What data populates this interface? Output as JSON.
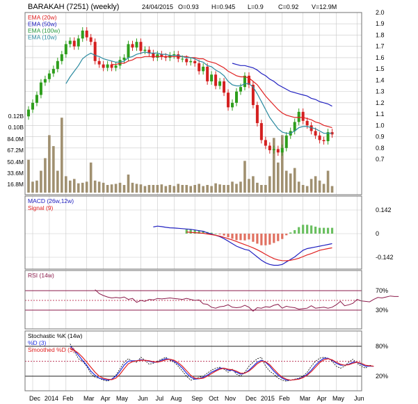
{
  "header": {
    "title": "BARAKAH (7251) (weekly)",
    "date": "24/04/2015",
    "open": "O=0.93",
    "high": "H=0.945",
    "low": "L=0.9",
    "close": "C=0.92",
    "volume": "V=12.9M"
  },
  "colors": {
    "up": "#2e9e1c",
    "down": "#d42020",
    "volume": "#a09070",
    "ema20": "#e02020",
    "ema50": "#2020c0",
    "ema100": "#2a9a40",
    "ema10": "#2a8aa0",
    "grid": "#c8c8c8",
    "frame": "#888888",
    "rsi_band": "#8b1a4a",
    "stoch_k": "#000000",
    "stoch_d": "#2030e0",
    "stoch_sd": "#e02020",
    "macd_hist_pos": "#6abf60",
    "macd_hist_neg": "#e07060"
  },
  "chart_data": [
    {
      "type": "candlestick",
      "panel": "price",
      "title": "BARAKAH (7251) (weekly)",
      "legend": [
        "EMA (20w)",
        "EMA (50w)",
        "EMA (100w)",
        "EMA (10w)"
      ],
      "legend_placement": "top-left",
      "y_ticks": [
        "2.0",
        "1.9",
        "1.8",
        "1.7",
        "1.6",
        "1.5",
        "1.4",
        "1.3",
        "1.2",
        "1.1",
        "1.0",
        "0.9",
        "0.8",
        "0.7"
      ],
      "ylim": [
        0.6,
        2.0
      ],
      "volume_ticks": [
        "0.12B",
        "0.10B",
        "84.0M",
        "67.2M",
        "50.4M",
        "33.6M",
        "16.8M"
      ],
      "volume_max": 150,
      "x_labels": [
        "Dec",
        "2014",
        "Feb",
        "Mar",
        "Apr",
        "May",
        "Jun",
        "Jul",
        "Aug",
        "Sep",
        "Oct",
        "Nov",
        "Dec",
        "2015",
        "Feb",
        "Mar",
        "Apr",
        "May",
        "Jun"
      ],
      "x_label_weeks": [
        3,
        7,
        11,
        16,
        20,
        24,
        29,
        33,
        37,
        42,
        46,
        50,
        55,
        59,
        63,
        68,
        72,
        76,
        81
      ],
      "weeks": 74,
      "close": [
        1.14,
        1.2,
        1.27,
        1.38,
        1.41,
        1.46,
        1.5,
        1.57,
        1.63,
        1.72,
        1.75,
        1.7,
        1.77,
        1.84,
        1.78,
        1.74,
        1.57,
        1.54,
        1.51,
        1.54,
        1.51,
        1.53,
        1.58,
        1.6,
        1.72,
        1.69,
        1.74,
        1.66,
        1.67,
        1.64,
        1.6,
        1.63,
        1.61,
        1.6,
        1.62,
        1.63,
        1.59,
        1.59,
        1.56,
        1.57,
        1.55,
        1.48,
        1.52,
        1.39,
        1.45,
        1.35,
        1.39,
        1.29,
        1.16,
        1.2,
        1.3,
        1.34,
        1.44,
        1.36,
        1.18,
        1.02,
        0.87,
        0.82,
        0.78,
        0.79,
        0.76,
        0.8,
        0.91,
        0.95,
        1.03,
        1.12,
        1.04,
        1.0,
        0.95,
        0.91,
        0.87,
        0.86,
        0.94,
        0.92
      ],
      "ema20": [
        null,
        null,
        null,
        null,
        null,
        null,
        null,
        null,
        null,
        null,
        null,
        null,
        null,
        null,
        null,
        null,
        null,
        null,
        null,
        null,
        1.54,
        1.54,
        1.55,
        1.55,
        1.57,
        1.58,
        1.6,
        1.6,
        1.61,
        1.61,
        1.61,
        1.61,
        1.61,
        1.61,
        1.61,
        1.61,
        1.61,
        1.61,
        1.61,
        1.6,
        1.6,
        1.59,
        1.59,
        1.57,
        1.56,
        1.55,
        1.53,
        1.51,
        1.48,
        1.46,
        1.44,
        1.43,
        1.43,
        1.42,
        1.39,
        1.36,
        1.31,
        1.26,
        1.22,
        1.18,
        1.14,
        1.11,
        1.09,
        1.08,
        1.07,
        1.07,
        1.07,
        1.06,
        1.05,
        1.03,
        1.02,
        1.0,
        0.99,
        0.98
      ],
      "ema50": [
        null,
        null,
        null,
        null,
        null,
        null,
        null,
        null,
        null,
        null,
        null,
        null,
        null,
        null,
        null,
        null,
        null,
        null,
        null,
        null,
        null,
        null,
        null,
        null,
        null,
        null,
        null,
        null,
        null,
        null,
        null,
        null,
        null,
        null,
        null,
        null,
        null,
        null,
        null,
        null,
        null,
        null,
        null,
        null,
        null,
        null,
        null,
        null,
        null,
        1.55,
        1.54,
        1.53,
        1.53,
        1.52,
        1.51,
        1.49,
        1.46,
        1.44,
        1.41,
        1.39,
        1.36,
        1.34,
        1.32,
        1.3,
        1.29,
        1.28,
        1.27,
        1.26,
        1.24,
        1.23,
        1.21,
        1.2,
        1.19,
        1.17
      ],
      "ema100": [],
      "ema10": [
        null,
        null,
        null,
        null,
        null,
        null,
        null,
        null,
        null,
        1.37,
        1.43,
        1.48,
        1.53,
        1.59,
        1.62,
        1.64,
        1.62,
        1.61,
        1.59,
        1.58,
        1.57,
        1.56,
        1.56,
        1.57,
        1.6,
        1.61,
        1.63,
        1.64,
        1.65,
        1.64,
        1.64,
        1.64,
        1.63,
        1.63,
        1.62,
        1.62,
        1.62,
        1.61,
        1.6,
        1.6,
        1.59,
        1.57,
        1.56,
        1.53,
        1.52,
        1.49,
        1.47,
        1.44,
        1.39,
        1.36,
        1.35,
        1.35,
        1.37,
        1.37,
        1.34,
        1.28,
        1.21,
        1.14,
        1.07,
        1.02,
        0.97,
        0.94,
        0.93,
        0.93,
        0.95,
        0.98,
        0.99,
        0.99,
        0.98,
        0.97,
        0.95,
        0.93,
        0.93,
        0.93
      ],
      "volume": [
        60,
        20,
        22,
        40,
        63,
        105,
        85,
        40,
        137,
        30,
        22,
        25,
        17,
        18,
        20,
        55,
        22,
        20,
        18,
        14,
        15,
        16,
        18,
        14,
        33,
        18,
        16,
        15,
        12,
        14,
        14,
        14,
        15,
        12,
        14,
        12,
        16,
        14,
        14,
        12,
        14,
        16,
        12,
        14,
        12,
        17,
        15,
        14,
        14,
        20,
        16,
        20,
        58,
        25,
        30,
        18,
        14,
        14,
        30,
        100,
        55,
        105,
        40,
        35,
        45,
        20,
        14,
        12,
        25,
        30,
        22,
        16,
        40,
        12
      ]
    },
    {
      "type": "line",
      "panel": "macd",
      "legend": [
        "MACD (26w,12w)",
        "Signal (9)"
      ],
      "legend_placement": "top-left",
      "y_ticks": [
        "0.142",
        "0",
        "-0.142"
      ],
      "ylim": [
        -0.25,
        0.2
      ],
      "start_week": 30,
      "macd": [
        0.04,
        0.045,
        0.042,
        0.038,
        0.035,
        0.034,
        0.032,
        0.03,
        0.028,
        0.026,
        0.022,
        0.018,
        0.014,
        0.005,
        -0.002,
        -0.01,
        -0.018,
        -0.03,
        -0.045,
        -0.06,
        -0.075,
        -0.085,
        -0.095,
        -0.1,
        -0.12,
        -0.14,
        -0.16,
        -0.175,
        -0.185,
        -0.19,
        -0.19,
        -0.185,
        -0.17,
        -0.155,
        -0.14,
        -0.12,
        -0.1,
        -0.09,
        -0.085,
        -0.08,
        -0.075,
        -0.07,
        -0.065,
        -0.06
      ],
      "signal": [
        null,
        null,
        null,
        null,
        null,
        null,
        null,
        null,
        0.01,
        0.008,
        0.006,
        0.004,
        0.002,
        -0.002,
        -0.006,
        -0.01,
        -0.015,
        -0.022,
        -0.03,
        -0.038,
        -0.047,
        -0.057,
        -0.066,
        -0.075,
        -0.085,
        -0.097,
        -0.11,
        -0.125,
        -0.138,
        -0.15,
        -0.158,
        -0.162,
        -0.163,
        -0.16,
        -0.155,
        -0.148,
        -0.138,
        -0.128,
        -0.12,
        -0.11,
        -0.1,
        -0.095,
        -0.09,
        -0.085
      ],
      "histogram": [
        null,
        null,
        null,
        null,
        null,
        null,
        null,
        null,
        0.018,
        0.018,
        0.016,
        0.014,
        0.012,
        0.007,
        0.004,
        0.0,
        -0.003,
        -0.008,
        -0.015,
        -0.022,
        -0.028,
        -0.028,
        -0.029,
        -0.025,
        -0.035,
        -0.043,
        -0.05,
        -0.05,
        -0.047,
        -0.04,
        -0.032,
        -0.023,
        -0.007,
        0.005,
        0.015,
        0.028,
        0.038,
        0.038,
        0.035,
        0.03,
        0.025,
        0.025,
        0.025,
        0.025
      ]
    },
    {
      "type": "line",
      "panel": "rsi",
      "legend": [
        "RSI (14w)"
      ],
      "legend_placement": "top-left",
      "y_ticks": [
        "70%",
        "30%"
      ],
      "ylim": [
        0,
        100
      ],
      "start_week": 16,
      "values": [
        72,
        64,
        60,
        57,
        55,
        56,
        55,
        57,
        52,
        54,
        46,
        50,
        48,
        52,
        51,
        54,
        53,
        54,
        55,
        54,
        53,
        52,
        54,
        52,
        50,
        51,
        43,
        42,
        36,
        34,
        37,
        38,
        41,
        36,
        35,
        36,
        40,
        36,
        28,
        35,
        34,
        37,
        36,
        40,
        42,
        34,
        38,
        36,
        35,
        32,
        33,
        34,
        39,
        34,
        35,
        36,
        34,
        36,
        41,
        48,
        39,
        41,
        44,
        52,
        49,
        48,
        47,
        52,
        56,
        55,
        57,
        59,
        58,
        58
      ]
    },
    {
      "type": "line",
      "panel": "stochastic",
      "legend": [
        "Stochastic %K (14w)",
        "%D (3)",
        "Smoothed %D (3)"
      ],
      "legend_placement": "top-left",
      "y_ticks": [
        "80%",
        "20%"
      ],
      "ylim": [
        0,
        100
      ],
      "start_week": 10,
      "k": [
        85,
        70,
        55,
        50,
        40,
        25,
        18,
        16,
        12,
        10,
        14,
        22,
        35,
        48,
        55,
        50,
        48,
        58,
        52,
        44,
        46,
        50,
        54,
        58,
        52,
        48,
        40,
        30,
        20,
        12,
        14,
        18,
        20,
        26,
        32,
        36,
        38,
        34,
        28,
        34,
        24,
        20,
        28,
        40,
        48,
        55,
        58,
        40,
        30,
        24,
        16,
        12,
        10,
        12,
        14,
        16,
        20,
        28,
        40,
        50,
        56,
        58,
        56,
        50,
        40,
        36,
        40,
        48,
        54,
        46,
        40,
        36,
        42,
        40
      ],
      "d": [
        80,
        72,
        62,
        52,
        42,
        30,
        22,
        16,
        14,
        12,
        14,
        20,
        30,
        42,
        50,
        51,
        51,
        53,
        52,
        50,
        48,
        48,
        52,
        55,
        54,
        50,
        44,
        36,
        26,
        18,
        14,
        15,
        18,
        22,
        28,
        32,
        36,
        36,
        32,
        32,
        28,
        24,
        26,
        32,
        40,
        48,
        52,
        48,
        40,
        30,
        22,
        16,
        12,
        12,
        13,
        15,
        18,
        24,
        32,
        42,
        50,
        56,
        56,
        52,
        46,
        42,
        42,
        44,
        48,
        48,
        44,
        40,
        40,
        40
      ],
      "sd": [
        75,
        72,
        66,
        58,
        48,
        38,
        28,
        20,
        16,
        14,
        13,
        16,
        24,
        35,
        45,
        49,
        51,
        52,
        52,
        51,
        49,
        48,
        50,
        53,
        54,
        52,
        47,
        40,
        31,
        22,
        16,
        15,
        16,
        20,
        25,
        30,
        34,
        36,
        34,
        33,
        30,
        26,
        26,
        30,
        37,
        45,
        50,
        49,
        43,
        34,
        25,
        18,
        14,
        12,
        13,
        14,
        17,
        22,
        29,
        38,
        47,
        53,
        55,
        53,
        48,
        44,
        42,
        43,
        46,
        48,
        46,
        42,
        41,
        40
      ]
    }
  ]
}
